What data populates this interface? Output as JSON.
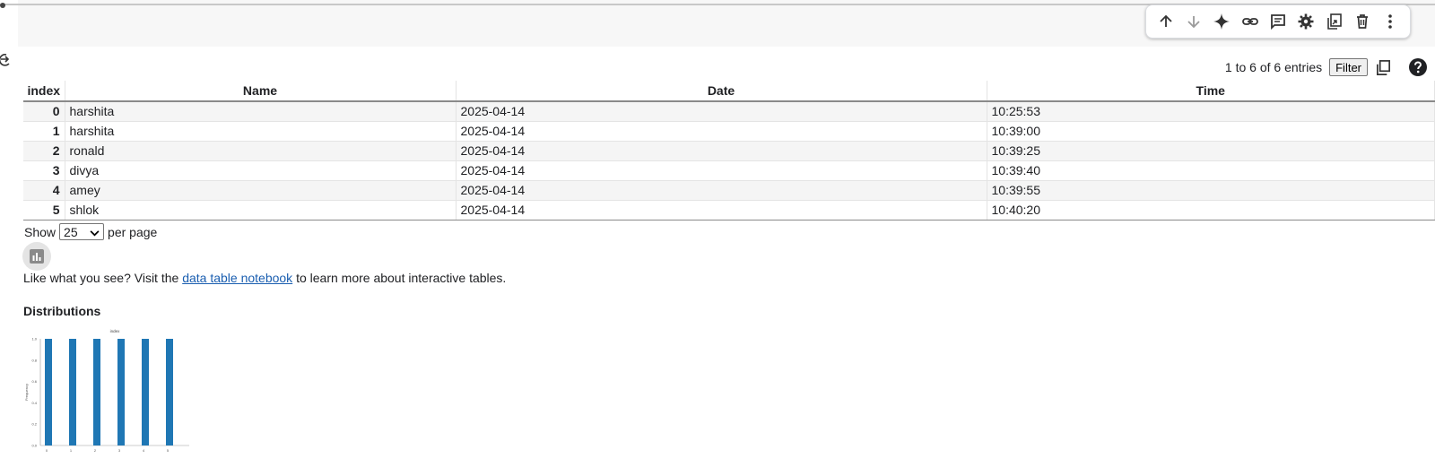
{
  "toolbar": {
    "icons": [
      "arrow-up-icon",
      "arrow-down-icon",
      "sparkle-icon",
      "link-icon",
      "comment-icon",
      "gear-icon",
      "mirror-cell-icon",
      "trash-icon",
      "more-vert-icon"
    ]
  },
  "table_controls": {
    "entries_text": "1 to 6 of 6 entries",
    "filter_label": "Filter"
  },
  "table": {
    "columns": [
      "index",
      "Name",
      "Date",
      "Time"
    ],
    "rows": [
      [
        "0",
        "harshita",
        "2025-04-14",
        "10:25:53"
      ],
      [
        "1",
        "harshita",
        "2025-04-14",
        "10:39:00"
      ],
      [
        "2",
        "ronald",
        "2025-04-14",
        "10:39:25"
      ],
      [
        "3",
        "divya",
        "2025-04-14",
        "10:39:40"
      ],
      [
        "4",
        "amey",
        "2025-04-14",
        "10:39:55"
      ],
      [
        "5",
        "shlok",
        "2025-04-14",
        "10:40:20"
      ]
    ]
  },
  "pagination": {
    "show_label": "Show",
    "per_page_value": "25",
    "per_page_label": "per page"
  },
  "promo": {
    "prefix": "Like what you see? Visit the",
    "link_text": "data table notebook",
    "suffix": "to learn more about interactive tables."
  },
  "distributions": {
    "heading": "Distributions"
  },
  "chart_data": {
    "type": "bar",
    "title": "index",
    "xlabel": "",
    "ylabel": "Frequency",
    "categories": [
      "0",
      "1",
      "2",
      "3",
      "4",
      "5"
    ],
    "values": [
      1,
      1,
      1,
      1,
      1,
      1
    ],
    "ylim": [
      0,
      1
    ],
    "yticks": [
      "0.0",
      "0.2",
      "0.4",
      "0.6",
      "0.8",
      "1.0"
    ],
    "color": "#1f77b4"
  },
  "colors": {
    "link": "#1a5eb0",
    "bar": "#1f77b4"
  }
}
